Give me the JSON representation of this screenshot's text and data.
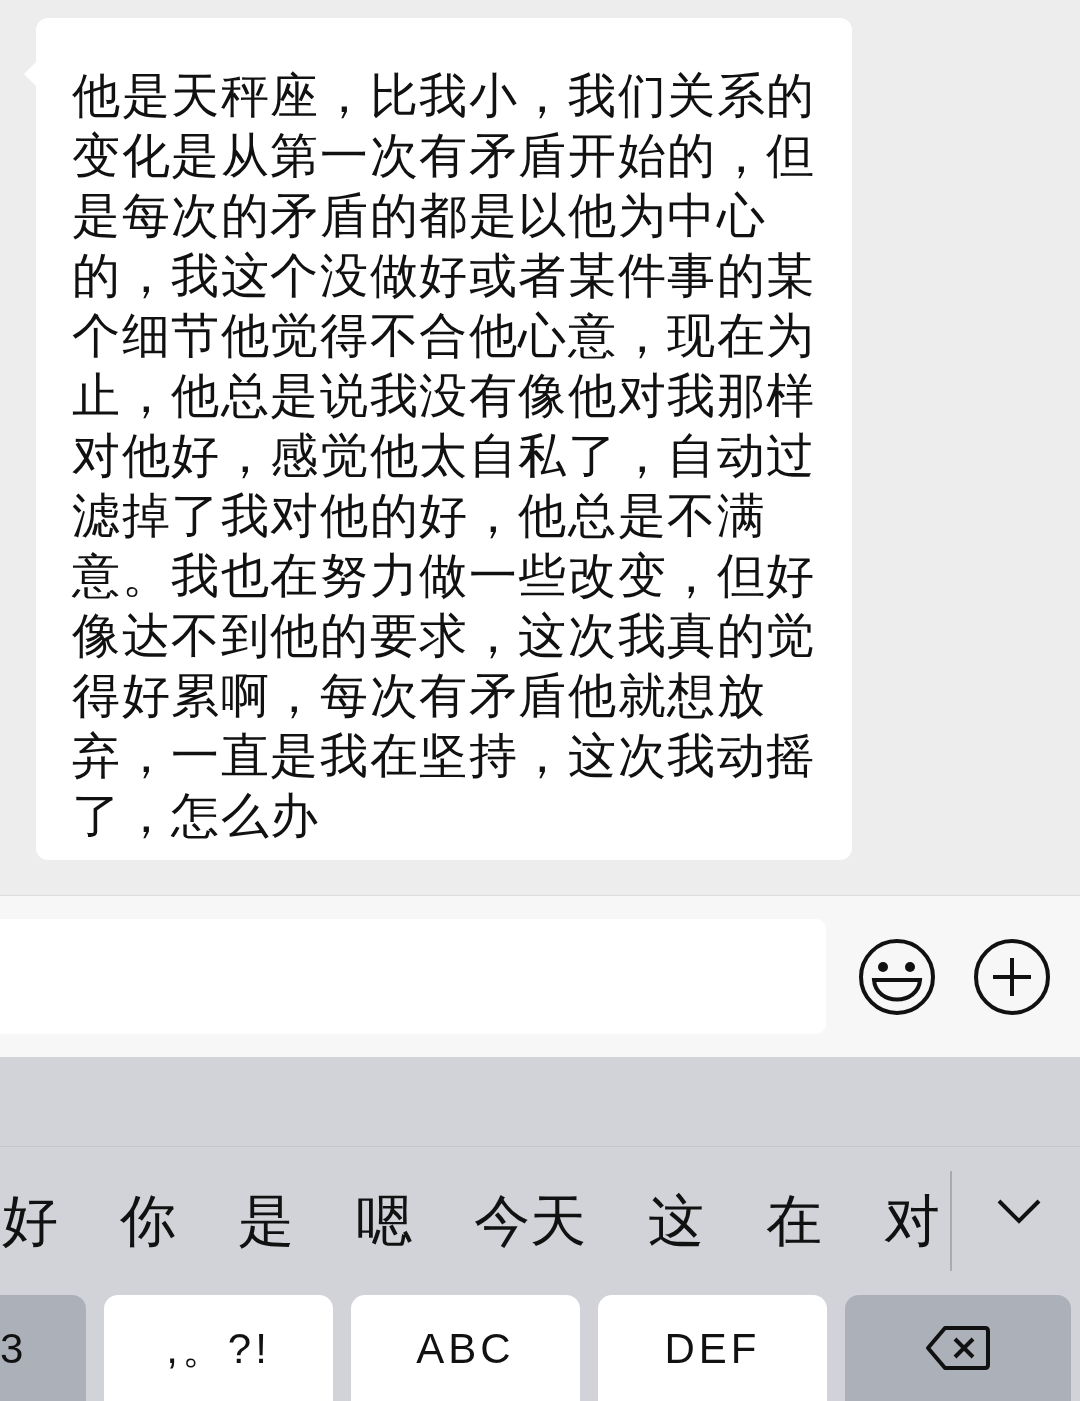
{
  "message": {
    "text": "他是天秤座，比我小，我们关系的变化是从第一次有矛盾开始的，但是每次的矛盾的都是以他为中心的，我这个没做好或者某件事的某个细节他觉得不合他心意，现在为止，他总是说我没有像他对我那样对他好，感觉他太自私了，自动过滤掉了我对他的好，他总是不满意。我也在努力做一些改变，但好像达不到他的要求，这次我真的觉得好累啊，每次有矛盾他就想放弃，一直是我在坚持，这次我动摇了，怎么办"
  },
  "candidates": [
    "好",
    "你",
    "是",
    "嗯",
    "今天",
    "这",
    "在",
    "对"
  ],
  "keys": [
    {
      "kind": "function",
      "label": "3"
    },
    {
      "kind": "letter",
      "label": ",。?!"
    },
    {
      "kind": "letter",
      "label": "ABC"
    },
    {
      "kind": "letter",
      "label": "DEF"
    },
    {
      "kind": "backspace"
    }
  ]
}
